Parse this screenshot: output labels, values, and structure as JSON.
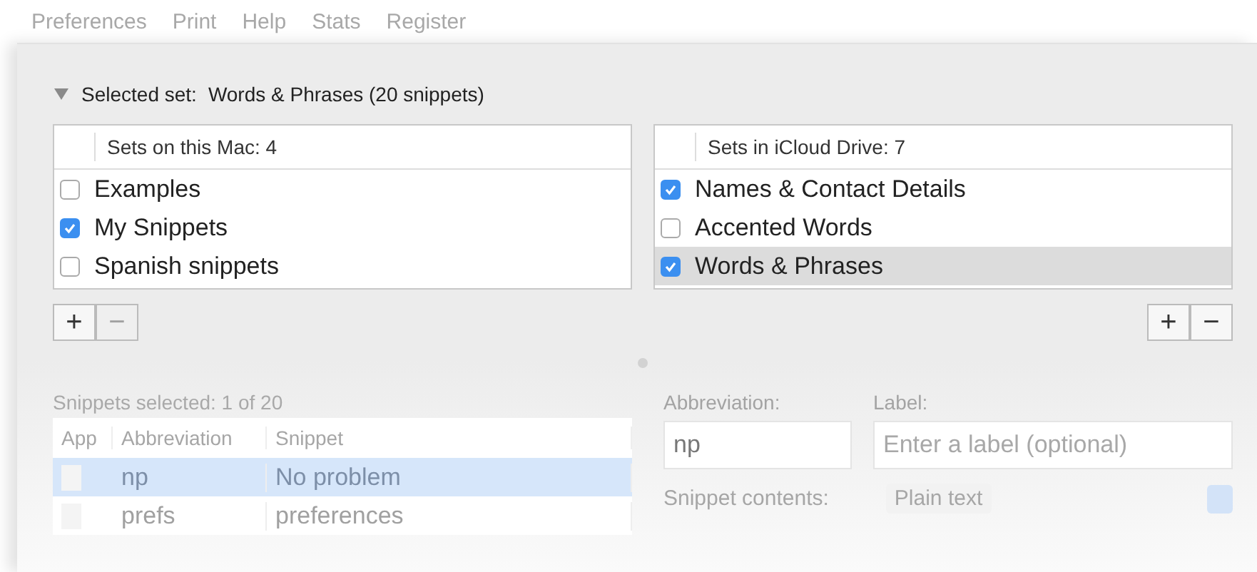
{
  "menu": [
    "Preferences",
    "Print",
    "Help",
    "Stats",
    "Register"
  ],
  "selected_set": {
    "expanded": true,
    "label": "Selected set:",
    "value": "Words & Phrases (20 snippets)"
  },
  "set_lists": [
    {
      "header": "Sets on this Mac: 4",
      "items": [
        {
          "label": "Examples",
          "checked": false,
          "selected": false
        },
        {
          "label": "My Snippets",
          "checked": true,
          "selected": false
        },
        {
          "label": "Spanish snippets",
          "checked": false,
          "selected": false
        }
      ],
      "add": "+",
      "remove": "−",
      "remove_disabled": true
    },
    {
      "header": "Sets in iCloud Drive: 7",
      "items": [
        {
          "label": "Names & Contact Details",
          "checked": true,
          "selected": false
        },
        {
          "label": "Accented Words",
          "checked": false,
          "selected": false
        },
        {
          "label": "Words & Phrases",
          "checked": true,
          "selected": true
        }
      ],
      "add": "+",
      "remove": "−",
      "remove_disabled": false
    }
  ],
  "snippets": {
    "count": "Snippets selected: 1 of 20",
    "columns": [
      "App",
      "Abbreviation",
      "Snippet"
    ],
    "rows": [
      {
        "abbreviation": "np",
        "snippet": "No problem",
        "selected": true
      },
      {
        "abbreviation": "prefs",
        "snippet": "preferences",
        "selected": false
      }
    ]
  },
  "abbreviation": {
    "label": "Abbreviation:",
    "value": "np"
  },
  "label_field": {
    "label": "Label:",
    "placeholder": "Enter a label (optional)"
  },
  "contents": {
    "label": "Snippet contents:",
    "value": "Plain text"
  }
}
